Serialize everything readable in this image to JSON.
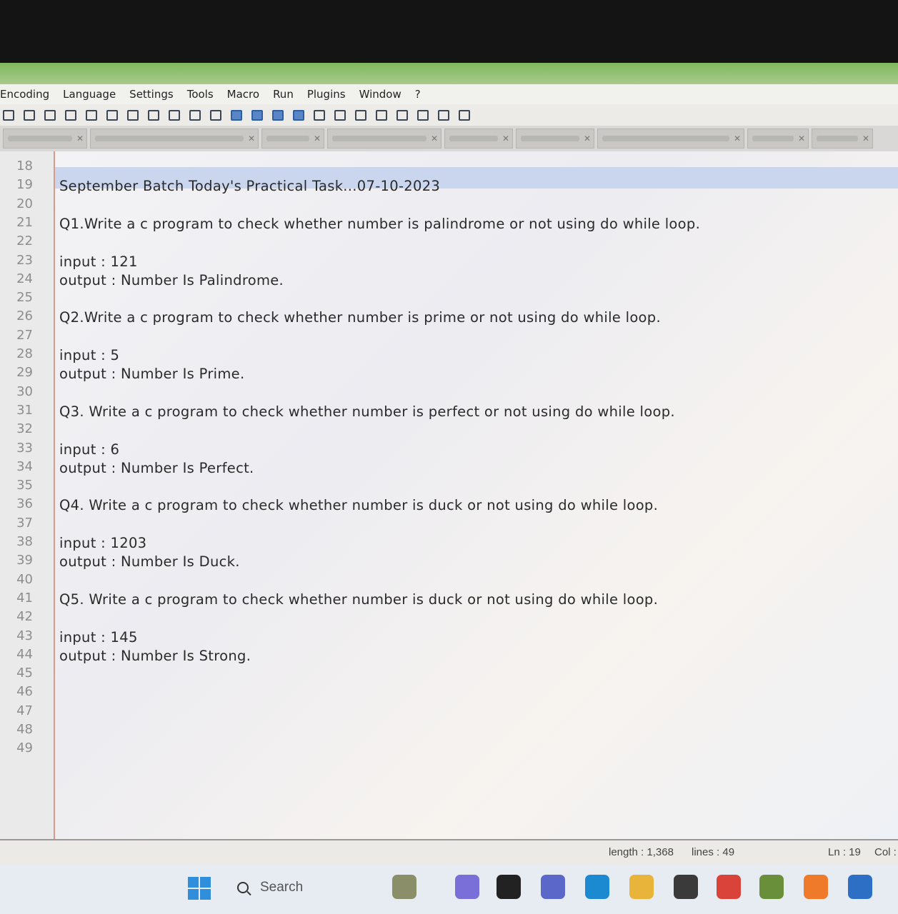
{
  "menu": [
    "Encoding",
    "Language",
    "Settings",
    "Tools",
    "Macro",
    "Run",
    "Plugins",
    "Window",
    "?"
  ],
  "toolbar_icons": [
    "cut-icon",
    "copy-icon",
    "paste-icon",
    "undo-icon",
    "redo-icon",
    "find-icon",
    "replace-icon",
    "zoom-in-icon",
    "zoom-out-icon",
    "sync-v-icon",
    "sync-h-icon",
    "word-wrap-icon",
    "show-all-chars-icon",
    "indent-guide-icon",
    "doc-map-icon",
    "function-list-icon",
    "folder-workspace-icon",
    "monitoring-icon",
    "record-macro-icon",
    "stop-record-icon",
    "playback-macro-icon",
    "run-macro-multiple-icon",
    "save-macro-icon"
  ],
  "editor": {
    "lines": [
      {
        "num": "18",
        "text": ""
      },
      {
        "num": "19",
        "text": "September  Batch Today's Practical Task...07-10-2023"
      },
      {
        "num": "20",
        "text": ""
      },
      {
        "num": "21",
        "text": "Q1.Write a c program to check whether number is palindrome or not using do while loop."
      },
      {
        "num": "22",
        "text": ""
      },
      {
        "num": "23",
        "text": "input : 121"
      },
      {
        "num": "24",
        "text": "output : Number Is Palindrome."
      },
      {
        "num": "25",
        "text": ""
      },
      {
        "num": "26",
        "text": "Q2.Write a c program to check whether number is prime or not using do while loop."
      },
      {
        "num": "27",
        "text": ""
      },
      {
        "num": "28",
        "text": "input : 5"
      },
      {
        "num": "29",
        "text": "output : Number Is Prime."
      },
      {
        "num": "30",
        "text": ""
      },
      {
        "num": "31",
        "text": "Q3. Write a c program to check whether number is perfect or not using do while loop."
      },
      {
        "num": "32",
        "text": ""
      },
      {
        "num": "33",
        "text": "input : 6"
      },
      {
        "num": "34",
        "text": "output : Number Is Perfect."
      },
      {
        "num": "35",
        "text": ""
      },
      {
        "num": "36",
        "text": "Q4. Write a c program to check whether number is duck or not using do while loop."
      },
      {
        "num": "37",
        "text": ""
      },
      {
        "num": "38",
        "text": "input : 1203"
      },
      {
        "num": "39",
        "text": "output : Number Is Duck."
      },
      {
        "num": "40",
        "text": ""
      },
      {
        "num": "41",
        "text": "Q5. Write a c program to check whether number is duck or not using do while loop."
      },
      {
        "num": "42",
        "text": ""
      },
      {
        "num": "43",
        "text": "input : 145"
      },
      {
        "num": "44",
        "text": "output : Number Is Strong."
      },
      {
        "num": "45",
        "text": ""
      },
      {
        "num": "46",
        "text": ""
      },
      {
        "num": "47",
        "text": ""
      },
      {
        "num": "48",
        "text": ""
      },
      {
        "num": "49",
        "text": ""
      }
    ]
  },
  "status": {
    "length": "length : 1,368",
    "lines": "lines : 49",
    "ln": "Ln : 19",
    "col": "Col :"
  },
  "taskbar": {
    "search_placeholder": "Search",
    "apps": [
      {
        "name": "widgets-icon",
        "color": "#8a8f6a"
      },
      {
        "name": "copilot-icon",
        "color": "#7a6fd8"
      },
      {
        "name": "task-view-icon",
        "color": "#222222"
      },
      {
        "name": "teams-chat-icon",
        "color": "#5b67c9"
      },
      {
        "name": "edge-icon",
        "color": "#1b8ad0"
      },
      {
        "name": "file-explorer-icon",
        "color": "#e8b43a"
      },
      {
        "name": "sticky-app-icon",
        "color": "#3a3a3a"
      },
      {
        "name": "chrome-icon",
        "color": "#d9433a"
      },
      {
        "name": "photos-icon",
        "color": "#6a8f3a"
      },
      {
        "name": "firefox-icon",
        "color": "#ef7a2a"
      },
      {
        "name": "vscode-like-icon",
        "color": "#2c6fc4"
      }
    ]
  }
}
